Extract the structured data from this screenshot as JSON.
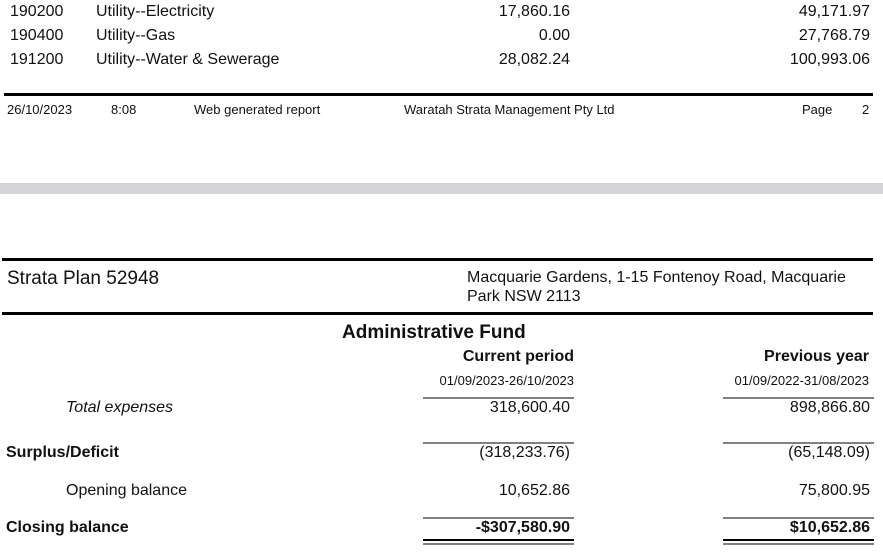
{
  "top_rows": [
    {
      "code": "190200",
      "description": "Utility--Electricity",
      "current": "17,860.16",
      "previous": "49,171.97"
    },
    {
      "code": "190400",
      "description": "Utility--Gas",
      "current": "0.00",
      "previous": "27,768.79"
    },
    {
      "code": "191200",
      "description": "Utility--Water & Sewerage",
      "current": "28,082.24",
      "previous": "100,993.06"
    }
  ],
  "footer": {
    "date": "26/10/2023",
    "time": "8:08",
    "generated": "Web generated report",
    "company": "Waratah Strata Management Pty Ltd",
    "page_label": "Page",
    "page_number": "2"
  },
  "header": {
    "plan": "Strata Plan 52948",
    "address": "Macquarie Gardens, 1-15 Fontenoy Road, Macquarie Park  NSW  2113"
  },
  "fund": {
    "title": "Administrative Fund",
    "current_label": "Current period",
    "current_range": "01/09/2023-26/10/2023",
    "previous_label": "Previous year",
    "previous_range": "01/09/2022-31/08/2023"
  },
  "summary": {
    "total_expenses": {
      "label": "Total expenses",
      "current": "318,600.40",
      "previous": "898,866.80"
    },
    "surplus_deficit": {
      "label": "Surplus/Deficit",
      "current": "(318,233.76)",
      "previous": "(65,148.09)"
    },
    "opening_balance": {
      "label": "Opening balance",
      "current": "10,652.86",
      "previous": "75,800.95"
    },
    "closing_balance": {
      "label": "Closing balance",
      "current": "-$307,580.90",
      "previous": "$10,652.86"
    }
  }
}
